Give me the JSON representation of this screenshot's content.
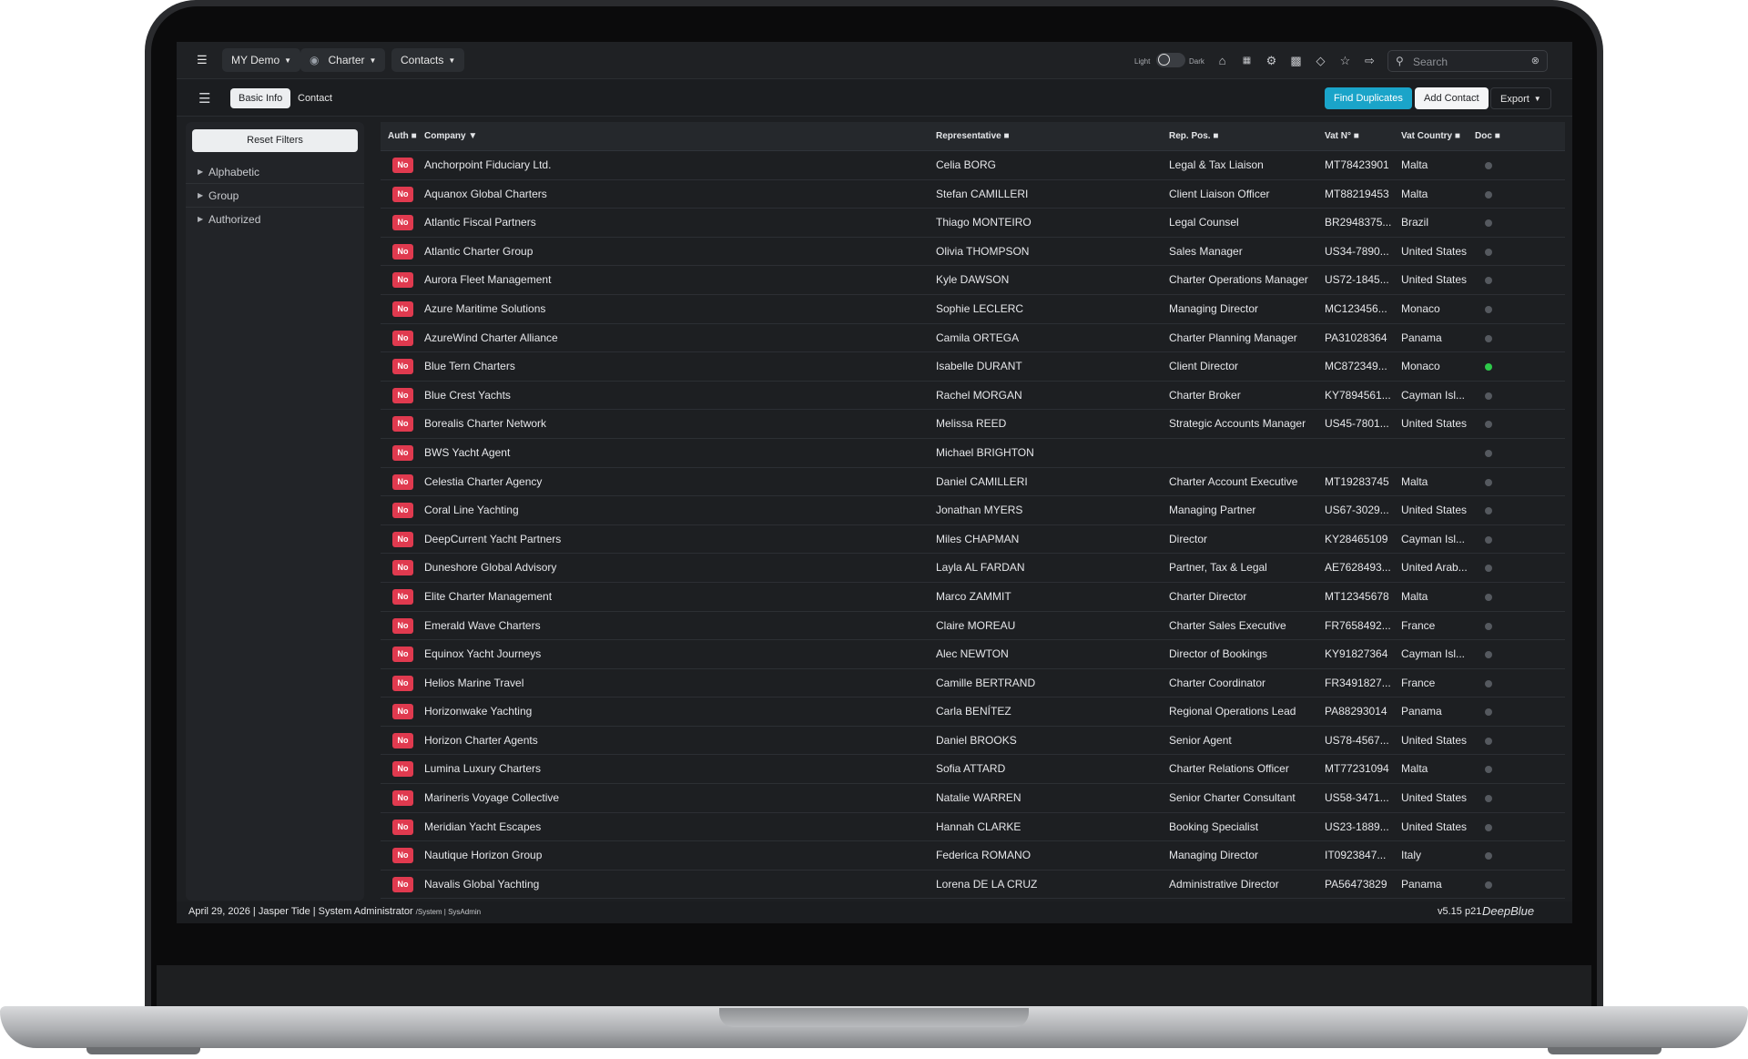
{
  "topbar": {
    "workspace": "MY Demo",
    "module": "Charter",
    "section": "Contacts",
    "mode_light": "Light",
    "mode_dark": "Dark",
    "search_placeholder": "Search",
    "icons": [
      "home-icon",
      "calendar-icon",
      "settings-icon",
      "grid-icon",
      "tag-icon",
      "star-icon",
      "logout-icon"
    ]
  },
  "subbar": {
    "tab_basic": "Basic Info",
    "tab_contact": "Contact",
    "find_duplicates": "Find Duplicates",
    "add_contact": "Add Contact",
    "export": "Export"
  },
  "sidebar": {
    "reset_filters": "Reset Filters",
    "filters": [
      "Alphabetic",
      "Group",
      "Authorized"
    ]
  },
  "table": {
    "headers": {
      "auth": "Auth",
      "company": "Company",
      "representative": "Representative",
      "rep_pos": "Rep. Pos.",
      "vat": "Vat N°",
      "vat_country": "Vat Country",
      "doc": "Doc"
    },
    "rows": [
      {
        "auth": "No",
        "company": "Anchorpoint Fiduciary Ltd.",
        "rep": " Celia  BORG",
        "pos": " Legal & Tax Liaison",
        "vat": "MT78423901",
        "country": "Malta",
        "doc": false
      },
      {
        "auth": "No",
        "company": "Aquanox Global Charters",
        "rep": "Stefan CAMILLERI",
        "pos": "Client Liaison Officer",
        "vat": "MT88219453",
        "country": "Malta",
        "doc": false
      },
      {
        "auth": "No",
        "company": "Atlantic Fiscal Partners",
        "rep": "Thiago MONTEIRO",
        "pos": " Legal Counsel",
        "vat": "BR2948375...",
        "country": "Brazil",
        "doc": false
      },
      {
        "auth": "No",
        "company": "Atlantic Charter Group",
        "rep": "Olivia THOMPSON",
        "pos": "Sales Manager",
        "vat": "US34-7890...",
        "country": "United States",
        "doc": false
      },
      {
        "auth": "No",
        "company": "Aurora Fleet Management",
        "rep": "Kyle DAWSON",
        "pos": "Charter Operations Manager",
        "vat": "US72-1845...",
        "country": "United States",
        "doc": false
      },
      {
        "auth": "No",
        "company": "Azure Maritime Solutions",
        "rep": "Sophie LECLERC",
        "pos": "Managing Director",
        "vat": "MC123456...",
        "country": "Monaco",
        "doc": false
      },
      {
        "auth": "No",
        "company": "AzureWind Charter Alliance",
        "rep": "Camila ORTEGA",
        "pos": "Charter Planning Manager",
        "vat": "PA31028364",
        "country": "Panama",
        "doc": false
      },
      {
        "auth": "No",
        "company": "Blue Tern Charters",
        "rep": "Isabelle DURANT",
        "pos": "Client Director",
        "vat": "MC872349...",
        "country": "Monaco",
        "doc": true
      },
      {
        "auth": "No",
        "company": "Blue Crest Yachts",
        "rep": "Rachel MORGAN",
        "pos": "Charter Broker",
        "vat": "KY7894561...",
        "country": "Cayman Isl...",
        "doc": false
      },
      {
        "auth": "No",
        "company": "Borealis Charter Network",
        "rep": "Melissa REED",
        "pos": "Strategic Accounts Manager",
        "vat": "US45-7801...",
        "country": "United States",
        "doc": false
      },
      {
        "auth": "No",
        "company": "BWS Yacht Agent",
        "rep": "Michael BRIGHTON",
        "pos": "",
        "vat": "",
        "country": "",
        "doc": false
      },
      {
        "auth": "No",
        "company": "Celestia Charter Agency",
        "rep": "Daniel CAMILLERI",
        "pos": "Charter Account Executive",
        "vat": "MT19283745",
        "country": "Malta",
        "doc": false
      },
      {
        "auth": "No",
        "company": "Coral Line Yachting",
        "rep": "Jonathan MYERS",
        "pos": "Managing Partner",
        "vat": "US67-3029...",
        "country": "United States",
        "doc": false
      },
      {
        "auth": "No",
        "company": "DeepCurrent Yacht Partners",
        "rep": "Miles CHAPMAN",
        "pos": "Director",
        "vat": "KY28465109",
        "country": "Cayman Isl...",
        "doc": false
      },
      {
        "auth": "No",
        "company": "Duneshore Global Advisory",
        "rep": " Layla  AL FARDAN",
        "pos": " Partner, Tax & Legal",
        "vat": "AE7628493...",
        "country": "United Arab...",
        "doc": false
      },
      {
        "auth": "No",
        "company": "Elite Charter Management",
        "rep": "Marco ZAMMIT",
        "pos": "Charter Director",
        "vat": "MT12345678",
        "country": "Malta",
        "doc": false
      },
      {
        "auth": "No",
        "company": "Emerald Wave Charters",
        "rep": "Claire MOREAU",
        "pos": "Charter Sales Executive",
        "vat": "FR7658492...",
        "country": "France",
        "doc": false
      },
      {
        "auth": "No",
        "company": "Equinox Yacht Journeys",
        "rep": "Alec NEWTON",
        "pos": "Director of Bookings",
        "vat": "KY91827364",
        "country": "Cayman Isl...",
        "doc": false
      },
      {
        "auth": "No",
        "company": "Helios Marine Travel",
        "rep": " Camille  BERTRAND",
        "pos": " Charter Coordinator",
        "vat": "FR3491827...",
        "country": "France",
        "doc": false
      },
      {
        "auth": "No",
        "company": "Horizonwake Yachting",
        "rep": "Carla BENÍTEZ",
        "pos": "Regional Operations Lead",
        "vat": "PA88293014",
        "country": "Panama",
        "doc": false
      },
      {
        "auth": "No",
        "company": "Horizon Charter Agents",
        "rep": "Daniel BROOKS",
        "pos": "Senior Agent",
        "vat": "US78-4567...",
        "country": "United States",
        "doc": false
      },
      {
        "auth": "No",
        "company": "Lumina Luxury Charters",
        "rep": "Sofia ATTARD",
        "pos": "Charter Relations Officer",
        "vat": "MT77231094",
        "country": "Malta",
        "doc": false
      },
      {
        "auth": "No",
        "company": "Marineris Voyage Collective",
        "rep": "Natalie WARREN",
        "pos": "Senior Charter Consultant",
        "vat": "US58-3471...",
        "country": "United States",
        "doc": false
      },
      {
        "auth": "No",
        "company": "Meridian Yacht Escapes",
        "rep": "Hannah CLARKE",
        "pos": "Booking Specialist",
        "vat": "US23-1889...",
        "country": "United States",
        "doc": false
      },
      {
        "auth": "No",
        "company": "Nautique Horizon Group",
        "rep": "Federica ROMANO",
        "pos": "Managing Director",
        "vat": "IT0923847...",
        "country": "Italy",
        "doc": false
      },
      {
        "auth": "No",
        "company": "Navalis Global Yachting",
        "rep": "Lorena DE LA CRUZ",
        "pos": "Administrative Director",
        "vat": "PA56473829",
        "country": "Panama",
        "doc": false
      }
    ]
  },
  "footer": {
    "status": "April 29, 2026 | Jasper Tide | System Administrator ",
    "status_small": "/System | SysAdmin",
    "version": "v5.15 p21",
    "brand": "DeepBlue"
  },
  "colors": {
    "accent": "#1aa4c9",
    "badge_no": "#e03a4f",
    "doc_on": "#2ec94a",
    "doc_off": "#55595f"
  }
}
